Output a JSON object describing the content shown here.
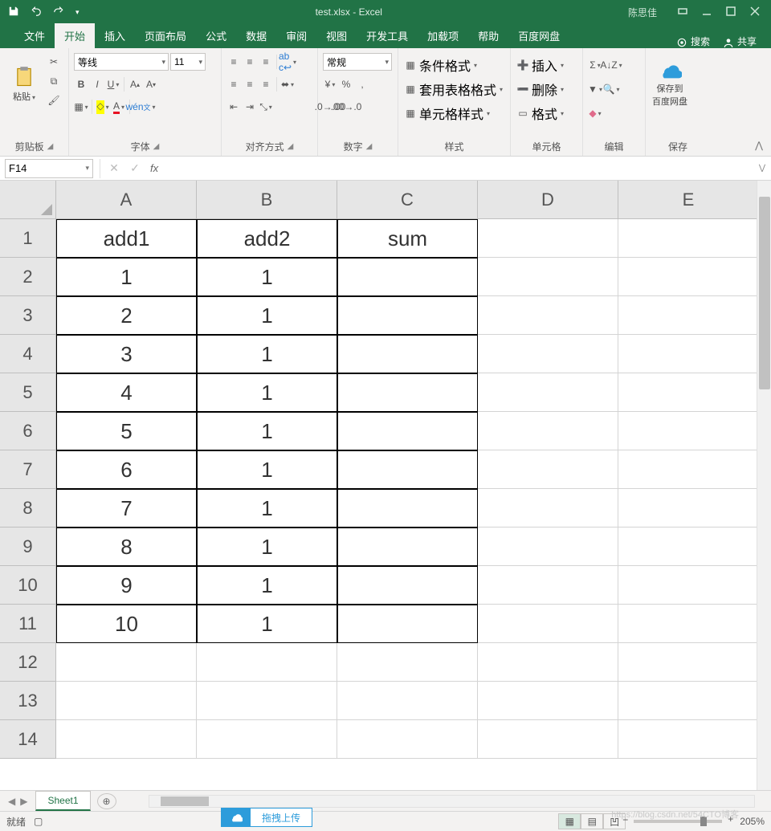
{
  "title": "test.xlsx  -  Excel",
  "user": "陈思佳",
  "tabs": [
    "文件",
    "开始",
    "插入",
    "页面布局",
    "公式",
    "数据",
    "审阅",
    "视图",
    "开发工具",
    "加载项",
    "帮助",
    "百度网盘"
  ],
  "active_tab": "开始",
  "search_label": "搜索",
  "share_label": "共享",
  "groups": {
    "clipboard": {
      "label": "剪贴板",
      "paste": "粘贴"
    },
    "font": {
      "label": "字体",
      "name": "等线",
      "size": "11"
    },
    "align": {
      "label": "对齐方式"
    },
    "number": {
      "label": "数字",
      "format": "常规"
    },
    "styles": {
      "label": "样式",
      "cond": "条件格式",
      "tbl": "套用表格格式",
      "cell": "单元格样式"
    },
    "cells": {
      "label": "单元格",
      "ins": "插入",
      "del": "删除",
      "fmt": "格式"
    },
    "edit": {
      "label": "编辑"
    },
    "save": {
      "label": "保存",
      "btn1": "保存到",
      "btn2": "百度网盘"
    }
  },
  "namebox": "F14",
  "formula": "",
  "columns": [
    "A",
    "B",
    "C",
    "D",
    "E"
  ],
  "row_count": 14,
  "data_region": {
    "rows": 11,
    "cols": 3
  },
  "cells": {
    "A1": "add1",
    "B1": "add2",
    "C1": "sum",
    "A2": "1",
    "B2": "1",
    "A3": "2",
    "B3": "1",
    "A4": "3",
    "B4": "1",
    "A5": "4",
    "B5": "1",
    "A6": "5",
    "B6": "1",
    "A7": "6",
    "B7": "1",
    "A8": "7",
    "B8": "1",
    "A9": "8",
    "B9": "1",
    "A10": "9",
    "B10": "1",
    "A11": "10",
    "B11": "1"
  },
  "sheet": "Sheet1",
  "status": "就绪",
  "zoom": "205%",
  "upload": "拖拽上传",
  "watermark": "https://blog.csdn.net/54CTO博客"
}
